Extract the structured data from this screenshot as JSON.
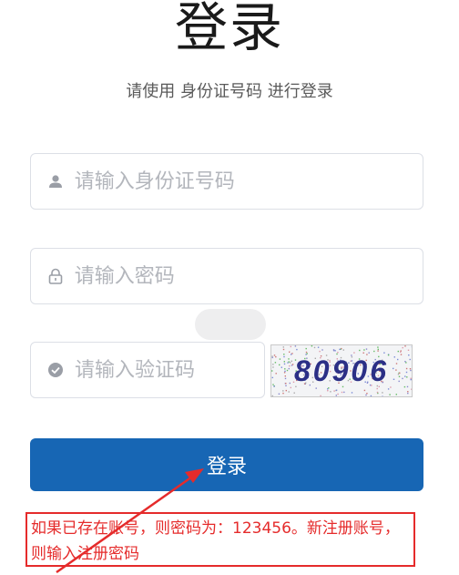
{
  "page": {
    "title": "登录",
    "subtitle": "请使用 身份证号码 进行登录"
  },
  "form": {
    "id_placeholder": "请输入身份证号码",
    "password_placeholder": "请输入密码",
    "captcha_placeholder": "请输入验证码",
    "captcha_text": "80906"
  },
  "login_button": {
    "label": "登录"
  },
  "annotation": {
    "text": "如果已存在账号，则密码为：123456。新注册账号，则输入注册密码",
    "color": "#e52b2b"
  },
  "colors": {
    "primary": "#1766b4",
    "icon": "#9a9ea6",
    "placeholder": "#b3b6bc"
  },
  "icons": {
    "id_field": "user-icon",
    "password_field": "lock-icon",
    "captcha_field": "check-circle-icon"
  }
}
